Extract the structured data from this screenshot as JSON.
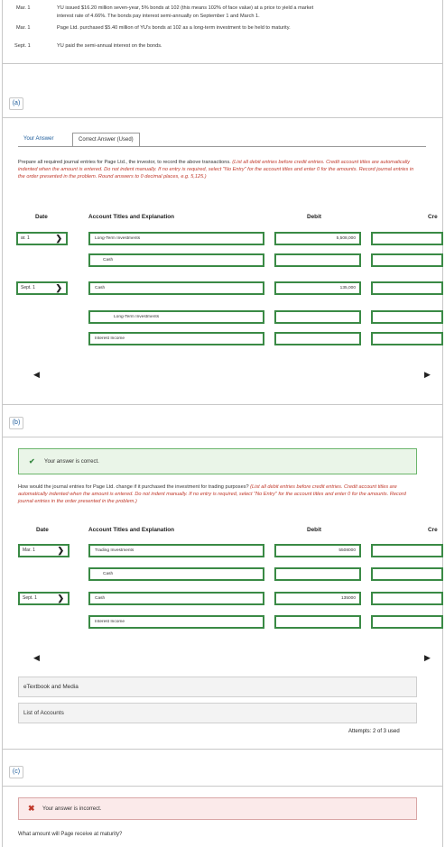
{
  "transactions": [
    {
      "date": "Mar.   1",
      "text_line1": "YU issued $16.20 million seven-year, 5% bonds at 102 (this means 102% of face value) at a price to yield a market",
      "text_line2": "interest rate of 4.66%. The bonds pay interest semi-annually on September 1 and March 1."
    },
    {
      "date": "Mar.   1",
      "text_line1": "Page Ltd. purchased $5.40 million of YU's bonds at 102 as a long-term investment to be held to maturity.",
      "text_line2": ""
    },
    {
      "date": "Sept.   1",
      "text_line1": "YU paid the semi-annual interest on the bonds.",
      "text_line2": ""
    }
  ],
  "part_a": {
    "label": "(a)",
    "tabs": {
      "your_answer": "Your Answer",
      "correct_answer": "Correct Answer (Used)"
    },
    "instructions_plain": "Prepare all required journal entries for Page Ltd., the investor, to record the above transactions.",
    "instructions_em": " (List all debit entries before credit entries. Credit account titles are automatically indented when the amount is entered. Do not indent manually. If no entry is required, select \"No Entry\" for the account titles and enter 0 for the amounts. Record journal entries in the order presented in the problem. Round answers to 0 decimal places, e.g. 5,125.)",
    "headers": {
      "date": "Date",
      "account": "Account Titles and Explanation",
      "debit": "Debit",
      "credit": "Cre"
    },
    "rows": [
      {
        "date": "ar. 1",
        "account": "Long-Term Investments",
        "debit": "5,508,000",
        "credit": ""
      },
      {
        "date": "",
        "account": "Cash",
        "debit": "",
        "credit": ""
      },
      {
        "date": "Sept. 1",
        "account": "Cash",
        "debit": "135,000",
        "credit": ""
      },
      {
        "date": "",
        "account": "Long-Term Investments",
        "debit": "",
        "credit": ""
      },
      {
        "date": "",
        "account": "Interest Income",
        "debit": "",
        "credit": ""
      }
    ]
  },
  "part_b": {
    "label": "(b)",
    "correct_msg": "Your answer is correct.",
    "question_plain": "How would the journal entries for Page Ltd. change if it purchased the investment for trading purposes?",
    "question_em": " (List all debit entries before credit entries. Credit account titles are automatically indented when the amount is entered. Do not indent manually. If no entry is required, select \"No Entry\" for the account titles and enter 0 for the amounts. Record journal entries in the order presented in the problem.)",
    "headers": {
      "date": "Date",
      "account": "Account Titles and Explanation",
      "debit": "Debit",
      "credit": "Cre"
    },
    "rows": [
      {
        "date": "Mar. 1",
        "account": "Trading Investments",
        "debit": "5508000",
        "credit": ""
      },
      {
        "date": "",
        "account": "Cash",
        "debit": "",
        "credit": ""
      },
      {
        "date": "Sept. 1",
        "account": "Cash",
        "debit": "135000",
        "credit": ""
      },
      {
        "date": "",
        "account": "Interest Income",
        "debit": "",
        "credit": ""
      }
    ],
    "etextbook": "eTextbook and Media",
    "list_accounts": "List of Accounts",
    "attempts": "Attempts: 2 of 3 used"
  },
  "part_c": {
    "label": "(c)",
    "incorrect_msg": "Your answer is incorrect.",
    "question": "What amount will Page receive at maturity?"
  },
  "colors": {
    "green_border": "#3a8a45",
    "correct_bg": "#eaf5e8",
    "incorrect_bg": "#fbeaea",
    "link": "#1a5a9a",
    "error": "#c0392b"
  }
}
